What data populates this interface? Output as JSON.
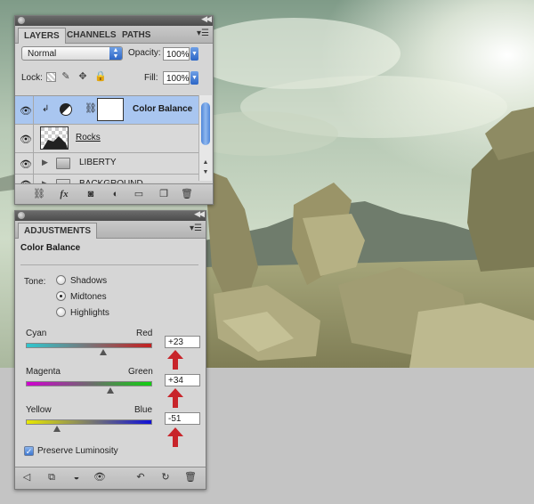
{
  "colors": {
    "selection": "#a9c6f0",
    "accent_blue": "#2d66c6",
    "arrow_red": "#c8242a"
  },
  "layers_panel": {
    "tabs": [
      "LAYERS",
      "CHANNELS",
      "PATHS"
    ],
    "active_tab": "LAYERS",
    "blend_mode": "Normal",
    "opacity_label": "Opacity:",
    "opacity_value": "100%",
    "lock_label": "Lock:",
    "fill_label": "Fill:",
    "fill_value": "100%",
    "layers": [
      {
        "name": "Color Balance",
        "type": "adjustment",
        "selected": true,
        "visible": true
      },
      {
        "name": "Rocks",
        "type": "pixel",
        "selected": false,
        "visible": true
      },
      {
        "name": "LIBERTY",
        "type": "group",
        "selected": false,
        "visible": true
      },
      {
        "name": "BACKGROUND",
        "type": "group",
        "selected": false,
        "visible": true
      }
    ],
    "bottom_icons": [
      "link-icon",
      "fx-icon",
      "mask-icon",
      "adjustment-icon",
      "folder-icon",
      "new-layer-icon",
      "trash-icon"
    ]
  },
  "adjustments_panel": {
    "tab": "ADJUSTMENTS",
    "title": "Color Balance",
    "tone_label": "Tone:",
    "tones": [
      "Shadows",
      "Midtones",
      "Highlights"
    ],
    "selected_tone": "Midtones",
    "sliders": [
      {
        "left": "Cyan",
        "right": "Red",
        "value": "+23",
        "level": 23,
        "gradient": [
          "#2fc7cf",
          "#c42020"
        ]
      },
      {
        "left": "Magenta",
        "right": "Green",
        "value": "+34",
        "level": 34,
        "gradient": [
          "#d000d0",
          "#10d010"
        ]
      },
      {
        "left": "Yellow",
        "right": "Blue",
        "value": "-51",
        "level": -51,
        "gradient": [
          "#e8e800",
          "#1010d8"
        ]
      }
    ],
    "preserve_luminosity_label": "Preserve Luminosity",
    "preserve_luminosity": true,
    "bottom_icons": [
      "back-arrow-icon",
      "fit-view-icon",
      "clip-icon",
      "eye-icon",
      "view-previous-icon",
      "reset-icon",
      "trash-icon"
    ]
  }
}
